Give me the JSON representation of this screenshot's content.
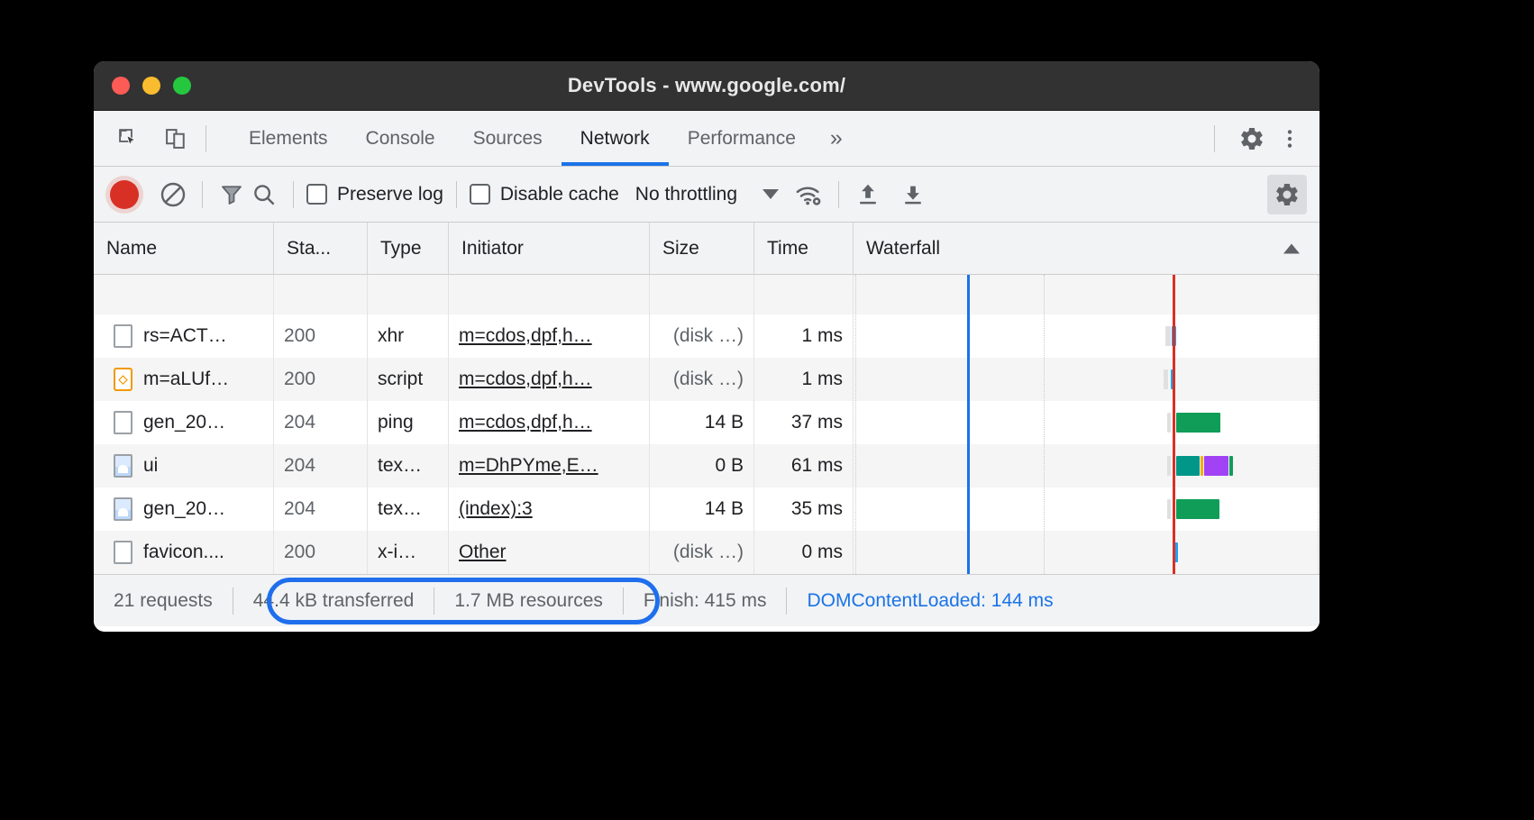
{
  "window": {
    "title": "DevTools - www.google.com/",
    "traffic_lights": [
      "close-button",
      "minimize-button",
      "zoom-button"
    ]
  },
  "tabstrip": {
    "left_icons": [
      "inspect-element-icon",
      "device-toolbar-icon"
    ],
    "tabs": [
      {
        "label": "Elements",
        "active": false
      },
      {
        "label": "Console",
        "active": false
      },
      {
        "label": "Sources",
        "active": false
      },
      {
        "label": "Network",
        "active": true
      },
      {
        "label": "Performance",
        "active": false
      }
    ],
    "more_label": "»",
    "right_icons": [
      "settings-gear-icon",
      "more-options-icon"
    ]
  },
  "network_toolbar": {
    "record_label": "record-button",
    "clear_label": "clear-button",
    "filter_label": "filter-button",
    "search_label": "search-button",
    "preserve_log": {
      "label": "Preserve log",
      "checked": false
    },
    "disable_cache": {
      "label": "Disable cache",
      "checked": false
    },
    "throttling": {
      "value": "No throttling"
    },
    "network_conditions_label": "network-conditions-button",
    "import_label": "import-har-button",
    "export_label": "export-har-button",
    "settings_label": "network-settings-button"
  },
  "table": {
    "columns": [
      {
        "key": "name",
        "label": "Name"
      },
      {
        "key": "status",
        "label": "Sta..."
      },
      {
        "key": "type",
        "label": "Type"
      },
      {
        "key": "initiator",
        "label": "Initiator"
      },
      {
        "key": "size",
        "label": "Size"
      },
      {
        "key": "time",
        "label": "Time"
      },
      {
        "key": "waterfall",
        "label": "Waterfall"
      }
    ],
    "sort_indicator": "sort-ascending-icon",
    "rows": [
      {
        "icon": "document-icon",
        "name": "rs=ACT…",
        "status": "200",
        "type": "xhr",
        "initiator": "m=cdos,dpf,h…",
        "size": "(disk …)",
        "time": "1 ms"
      },
      {
        "icon": "script-icon",
        "name": "m=aLUf…",
        "status": "200",
        "type": "script",
        "initiator": "m=cdos,dpf,h…",
        "size": "(disk …)",
        "time": "1 ms"
      },
      {
        "icon": "document-icon",
        "name": "gen_20…",
        "status": "204",
        "type": "ping",
        "initiator": "m=cdos,dpf,h…",
        "size": "14 B",
        "time": "37 ms"
      },
      {
        "icon": "image-icon",
        "name": "ui",
        "status": "204",
        "type": "tex…",
        "initiator": "m=DhPYme,E…",
        "size": "0 B",
        "time": "61 ms"
      },
      {
        "icon": "image-icon",
        "name": "gen_20…",
        "status": "204",
        "type": "tex…",
        "initiator": "(index):3",
        "size": "14 B",
        "time": "35 ms"
      },
      {
        "icon": "document-icon",
        "name": "favicon....",
        "status": "200",
        "type": "x-i…",
        "initiator": "Other",
        "size": "(disk …)",
        "time": "0 ms"
      }
    ]
  },
  "statusbar": {
    "requests": "21 requests",
    "transferred": "44.4 kB transferred",
    "resources": "1.7 MB resources",
    "finish": "Finish: 415 ms",
    "dom_content_loaded": "DOMContentLoaded: 144 ms",
    "highlight_target": "transferred-and-resources-highlight"
  },
  "colors": {
    "accent_blue": "#1a73e8",
    "record_red": "#d93025",
    "dcl_line": "#1a73e8",
    "load_line": "#d93025",
    "waterfall_green": "#0f9d58",
    "waterfall_teal": "#009688",
    "waterfall_purple": "#a142f4",
    "waterfall_cyan": "#1fa2f6",
    "highlight_ring": "#1f6fed"
  },
  "waterfall": {
    "dcl_line_x_pct": 24.5,
    "load_line_x_pct": 68.6,
    "gridline_pct": [
      0.6,
      41.0,
      99.6
    ],
    "bars": [
      {
        "row": 0,
        "segments": [
          {
            "left_pct": 67.0,
            "width_pct": 1.0,
            "color": "#e0e0e0"
          },
          {
            "left_pct": 68.2,
            "width_pct": 1.0,
            "color": "#1fa2f6"
          }
        ]
      },
      {
        "row": 1,
        "segments": [
          {
            "left_pct": 66.6,
            "width_pct": 1.0,
            "color": "#e0e0e0"
          },
          {
            "left_pct": 68.1,
            "width_pct": 0.9,
            "color": "#1fa2f6"
          }
        ]
      },
      {
        "row": 2,
        "segments": [
          {
            "left_pct": 67.3,
            "width_pct": 0.8,
            "color": "#e0e0e0"
          },
          {
            "left_pct": 69.3,
            "width_pct": 9.5,
            "color": "#0f9d58"
          }
        ]
      },
      {
        "row": 3,
        "segments": [
          {
            "left_pct": 67.3,
            "width_pct": 0.8,
            "color": "#e0e0e0"
          },
          {
            "left_pct": 69.3,
            "width_pct": 5.0,
            "color": "#009688"
          },
          {
            "left_pct": 74.5,
            "width_pct": 0.6,
            "color": "#f9ab00"
          },
          {
            "left_pct": 75.2,
            "width_pct": 5.2,
            "color": "#a142f4"
          },
          {
            "left_pct": 80.6,
            "width_pct": 0.8,
            "color": "#0f9d58"
          }
        ]
      },
      {
        "row": 4,
        "segments": [
          {
            "left_pct": 67.3,
            "width_pct": 0.8,
            "color": "#e0e0e0"
          },
          {
            "left_pct": 69.3,
            "width_pct": 9.3,
            "color": "#0f9d58"
          }
        ]
      },
      {
        "row": 5,
        "segments": [
          {
            "left_pct": 68.8,
            "width_pct": 0.9,
            "color": "#1fa2f6"
          }
        ]
      }
    ]
  }
}
